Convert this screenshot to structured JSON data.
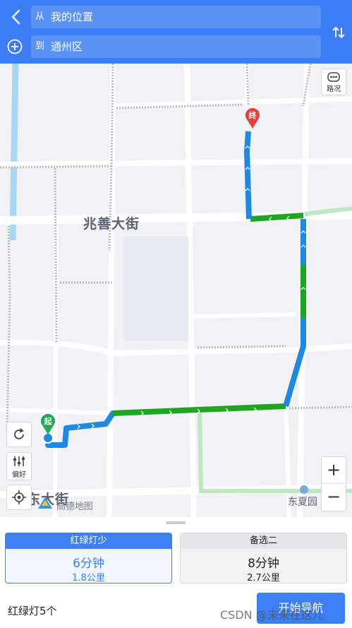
{
  "header": {
    "from_prefix": "从",
    "from_value": "我的位置",
    "to_prefix": "到",
    "to_value": "通州区"
  },
  "map": {
    "street_main": "兆善大街",
    "street_bottom": "东大街",
    "poi": "东夏园",
    "logo": "高德地图",
    "traffic_label": "路况",
    "pref_label": "偏好",
    "start_marker": "起",
    "end_marker": "终",
    "zoom_in": "+",
    "zoom_out": "−",
    "colors": {
      "route_blue": "#1e88e5",
      "route_green": "#1fa51f",
      "alt_route": "#bfe8c0",
      "road": "#ffffff",
      "rail": "#b9b9b9"
    }
  },
  "routes": [
    {
      "tag": "红绿灯少",
      "time": "6分钟",
      "distance": "1.8公里",
      "selected": true
    },
    {
      "tag": "备选二",
      "time": "8分钟",
      "distance": "2.7公里",
      "selected": false
    }
  ],
  "footer": {
    "traffic_lights": "红绿灯5个",
    "start_nav": "开始导航",
    "watermark": "CSDN @未来在这儿"
  }
}
